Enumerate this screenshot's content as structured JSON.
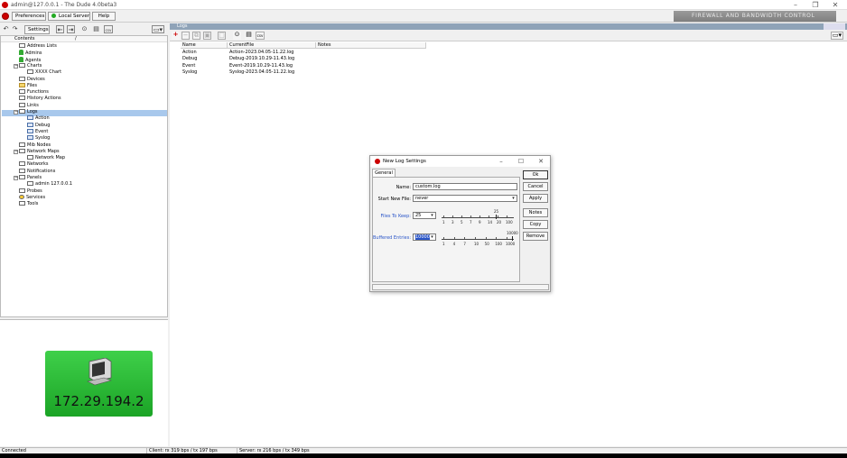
{
  "window": {
    "title": "admin@127.0.0.1 - The Dude 4.0beta3",
    "controls": [
      "–",
      "❐",
      "✕"
    ]
  },
  "toolbar": {
    "preferences_label": "Preferences",
    "server_label": "Local Server",
    "help_label": "Help",
    "brand_text": "FIREWALL AND BANDWIDTH CONTROL"
  },
  "left": {
    "settings_label": "Settings",
    "tree_header": "Contents",
    "tree": [
      {
        "label": "Address Lists",
        "icon": "list-icon",
        "indent": 0
      },
      {
        "label": "Admins",
        "icon": "person-icon",
        "indent": 0
      },
      {
        "label": "Agents",
        "icon": "person-icon",
        "indent": 0
      },
      {
        "label": "Charts",
        "icon": "list-icon",
        "indent": 0,
        "expand": "−"
      },
      {
        "label": "XXXX Chart",
        "icon": "list-icon",
        "indent": 1
      },
      {
        "label": "Devices",
        "icon": "list-icon",
        "indent": 0
      },
      {
        "label": "Files",
        "icon": "folder-icon",
        "indent": 0
      },
      {
        "label": "Functions",
        "icon": "list-icon",
        "indent": 0
      },
      {
        "label": "History Actions",
        "icon": "list-icon",
        "indent": 0
      },
      {
        "label": "Links",
        "icon": "list-icon",
        "indent": 0
      },
      {
        "label": "Logs",
        "icon": "list-icon",
        "indent": 0,
        "expand": "−",
        "selected": true
      },
      {
        "label": "Action",
        "icon": "log-icon",
        "indent": 1
      },
      {
        "label": "Debug",
        "icon": "log-icon",
        "indent": 1
      },
      {
        "label": "Event",
        "icon": "log-icon",
        "indent": 1
      },
      {
        "label": "Syslog",
        "icon": "log-icon",
        "indent": 1
      },
      {
        "label": "Mib Nodes",
        "icon": "list-icon",
        "indent": 0
      },
      {
        "label": "Network Maps",
        "icon": "list-icon",
        "indent": 0,
        "expand": "−"
      },
      {
        "label": "Network Map",
        "icon": "list-icon",
        "indent": 1
      },
      {
        "label": "Networks",
        "icon": "list-icon",
        "indent": 0
      },
      {
        "label": "Notifications",
        "icon": "list-icon",
        "indent": 0
      },
      {
        "label": "Panels",
        "icon": "list-icon",
        "indent": 0,
        "expand": "−"
      },
      {
        "label": "admin 127.0.0.1",
        "icon": "list-icon",
        "indent": 1
      },
      {
        "label": "Probes",
        "icon": "list-icon",
        "indent": 0
      },
      {
        "label": "Services",
        "icon": "probe-icon",
        "indent": 0
      },
      {
        "label": "Tools",
        "icon": "list-icon",
        "indent": 0
      }
    ],
    "device_ip": "172.29.194.2"
  },
  "logs": {
    "panel_title": "Logs",
    "columns": [
      "Name",
      "CurrentFile",
      "Notes"
    ],
    "rows": [
      {
        "name": "Action",
        "file": "Action-2023.04.05-11.22.log",
        "notes": ""
      },
      {
        "name": "Debug",
        "file": "Debug-2019.10.29-11.43.log",
        "notes": ""
      },
      {
        "name": "Event",
        "file": "Event-2019.10.29-11.43.log",
        "notes": ""
      },
      {
        "name": "Syslog",
        "file": "Syslog-2023.04.05-11.22.log",
        "notes": ""
      }
    ]
  },
  "dialog": {
    "title": "New Log Settings",
    "tab": "General",
    "name_label": "Name:",
    "name_value": "custom.log",
    "start_label": "Start New File:",
    "start_value": "never",
    "files_label": "Files To Keep:",
    "files_value": "25",
    "files_scale": [
      "1",
      "3",
      "5",
      "7",
      "9",
      "14",
      "20",
      "100"
    ],
    "files_marker": "25",
    "buffered_label": "Buffered Entries:",
    "buffered_value": "10000",
    "buffered_scale": [
      "1",
      "4",
      "7",
      "10",
      "50",
      "100",
      "1000"
    ],
    "buffered_marker": "10000",
    "buttons": [
      "Ok",
      "Cancel",
      "Apply",
      "Notes",
      "Copy",
      "Remove"
    ],
    "controls": [
      "–",
      "☐",
      "✕"
    ]
  },
  "status": {
    "connection": "Connected",
    "client": "Client: rx 319 bps / tx 197 bps",
    "server": "Server: rx 216 bps / tx 349 bps"
  }
}
